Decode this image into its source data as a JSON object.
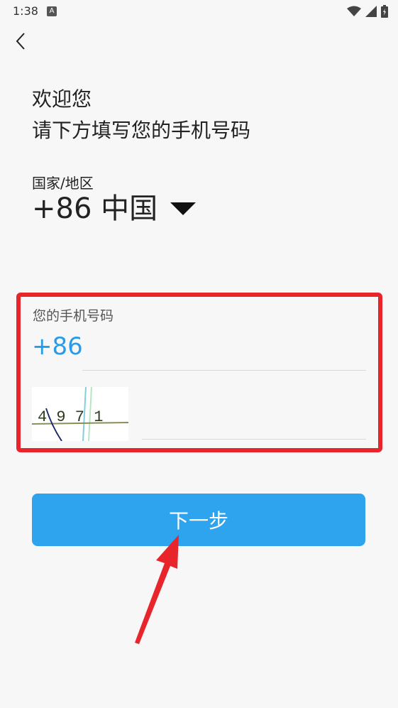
{
  "status": {
    "time": "1:38",
    "notification_badge": "A",
    "wifi_icon": "wifi-icon",
    "signal_icon": "signal-icon",
    "battery_icon": "battery-icon"
  },
  "header": {
    "back_icon": "chevron-left-icon"
  },
  "welcome": {
    "line1": "欢迎您",
    "line2": "请下方填写您的手机号码"
  },
  "region": {
    "label": "国家/地区",
    "value": "+86 中国"
  },
  "phone": {
    "label": "您的手机号码",
    "prefix": "+86",
    "value": ""
  },
  "captcha": {
    "image_text": "4 9 7 1",
    "value": ""
  },
  "next_button": {
    "label": "下一步"
  },
  "colors": {
    "accent": "#2ea3ee",
    "highlight": "#e8252b",
    "prefix": "#2a9be8"
  }
}
